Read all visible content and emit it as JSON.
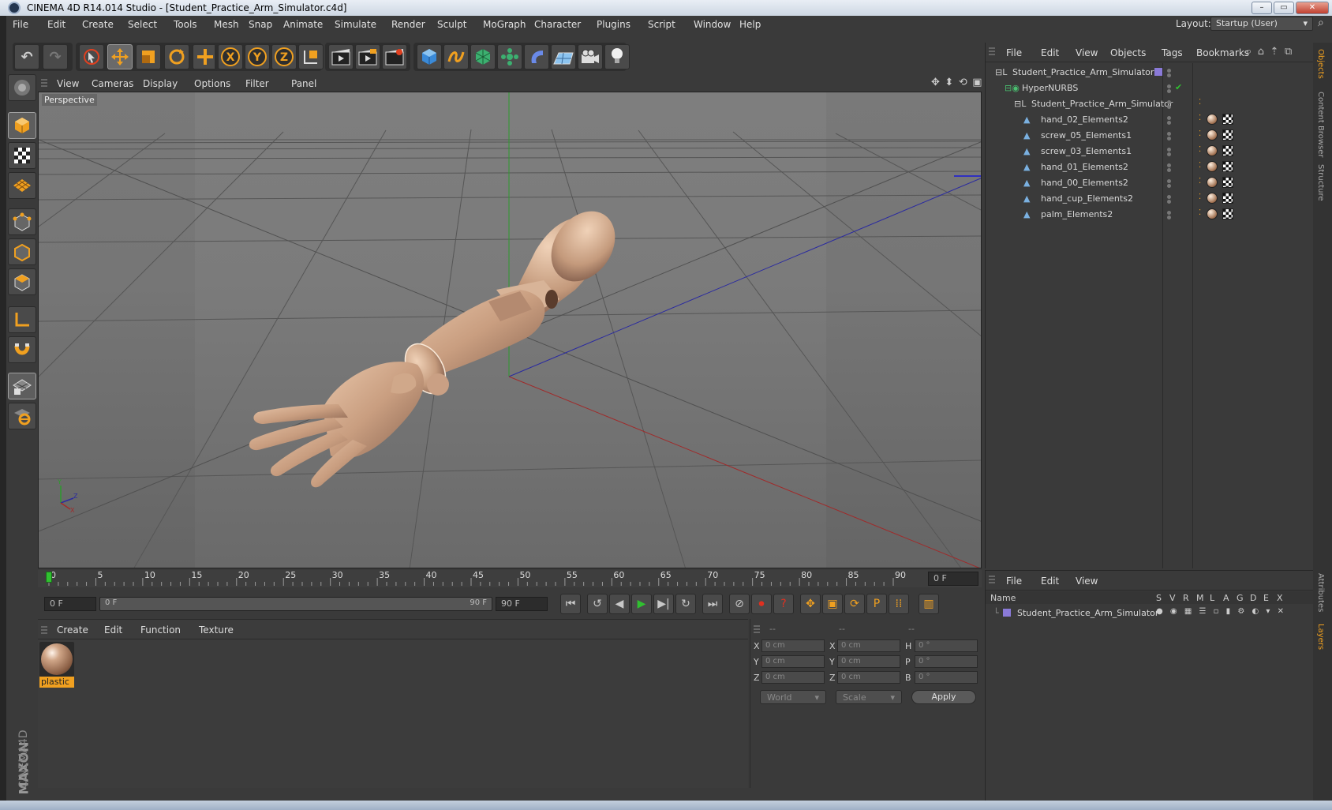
{
  "window": {
    "title": "CINEMA 4D R14.014 Studio - [Student_Practice_Arm_Simulator.c4d]"
  },
  "menu": [
    "File",
    "Edit",
    "Create",
    "Select",
    "Tools",
    "Mesh",
    "Snap",
    "Animate",
    "Simulate",
    "Render",
    "Sculpt",
    "MoGraph",
    "Character",
    "Plugins",
    "Script",
    "Window",
    "Help"
  ],
  "layout": {
    "label": "Layout:",
    "value": "Startup (User)"
  },
  "viewport": {
    "menu": [
      "View",
      "Cameras",
      "Display",
      "Options",
      "Filter",
      "Panel"
    ],
    "camera_label": "Perspective"
  },
  "timeline": {
    "ticks": [
      "0",
      "5",
      "10",
      "15",
      "20",
      "25",
      "30",
      "35",
      "40",
      "45",
      "50",
      "55",
      "60",
      "65",
      "70",
      "75",
      "80",
      "85",
      "90"
    ],
    "current_frame": "0 F",
    "start_field": "0 F",
    "range_start": "0 F",
    "range_end": "90 F",
    "end_field": "90 F"
  },
  "material_manager": {
    "menu": [
      "Create",
      "Edit",
      "Function",
      "Texture"
    ],
    "materials": [
      {
        "name": "plastic"
      }
    ]
  },
  "coordinates": {
    "headers": [
      "--",
      "--",
      "--"
    ],
    "rows": [
      {
        "label1": "X",
        "pos": "0 cm",
        "label2": "X",
        "size": "0 cm",
        "label3": "H",
        "rot": "0 °"
      },
      {
        "label1": "Y",
        "pos": "0 cm",
        "label2": "Y",
        "size": "0 cm",
        "label3": "P",
        "rot": "0 °"
      },
      {
        "label1": "Z",
        "pos": "0 cm",
        "label2": "Z",
        "size": "0 cm",
        "label3": "B",
        "rot": "0 °"
      }
    ],
    "mode": "World",
    "transform": "Scale",
    "apply": "Apply"
  },
  "object_manager": {
    "menu": [
      "File",
      "Edit",
      "View",
      "Objects",
      "Tags",
      "Bookmarks"
    ],
    "objects": [
      {
        "name": "Student_Practice_Arm_Simulator",
        "level": 0
      },
      {
        "name": "HyperNURBS",
        "level": 1
      },
      {
        "name": "Student_Practice_Arm_Simulator",
        "level": 2
      },
      {
        "name": "hand_02_Elements2",
        "level": 3
      },
      {
        "name": "screw_05_Elements1",
        "level": 3
      },
      {
        "name": "screw_03_Elements1",
        "level": 3
      },
      {
        "name": "hand_01_Elements2",
        "level": 3
      },
      {
        "name": "hand_00_Elements2",
        "level": 3
      },
      {
        "name": "hand_cup_Elements2",
        "level": 3
      },
      {
        "name": "palm_Elements2",
        "level": 3
      }
    ]
  },
  "layer_manager": {
    "menu": [
      "File",
      "Edit",
      "View"
    ],
    "columns": [
      "Name",
      "S",
      "V",
      "R",
      "M",
      "L",
      "A",
      "G",
      "D",
      "E",
      "X"
    ],
    "layers": [
      {
        "name": "Student_Practice_Arm_Simulator"
      }
    ]
  },
  "right_tabs": [
    "Objects",
    "Content Browser",
    "Structure",
    "Attributes",
    "Layers"
  ],
  "branding": {
    "maxon": "MAXON",
    "product": "CINEMA4D"
  },
  "colors": {
    "accent": "#f0a020",
    "selection": "#f0a020",
    "axis_x": "#c03030",
    "axis_y": "#30a030",
    "axis_z": "#3030c0"
  }
}
